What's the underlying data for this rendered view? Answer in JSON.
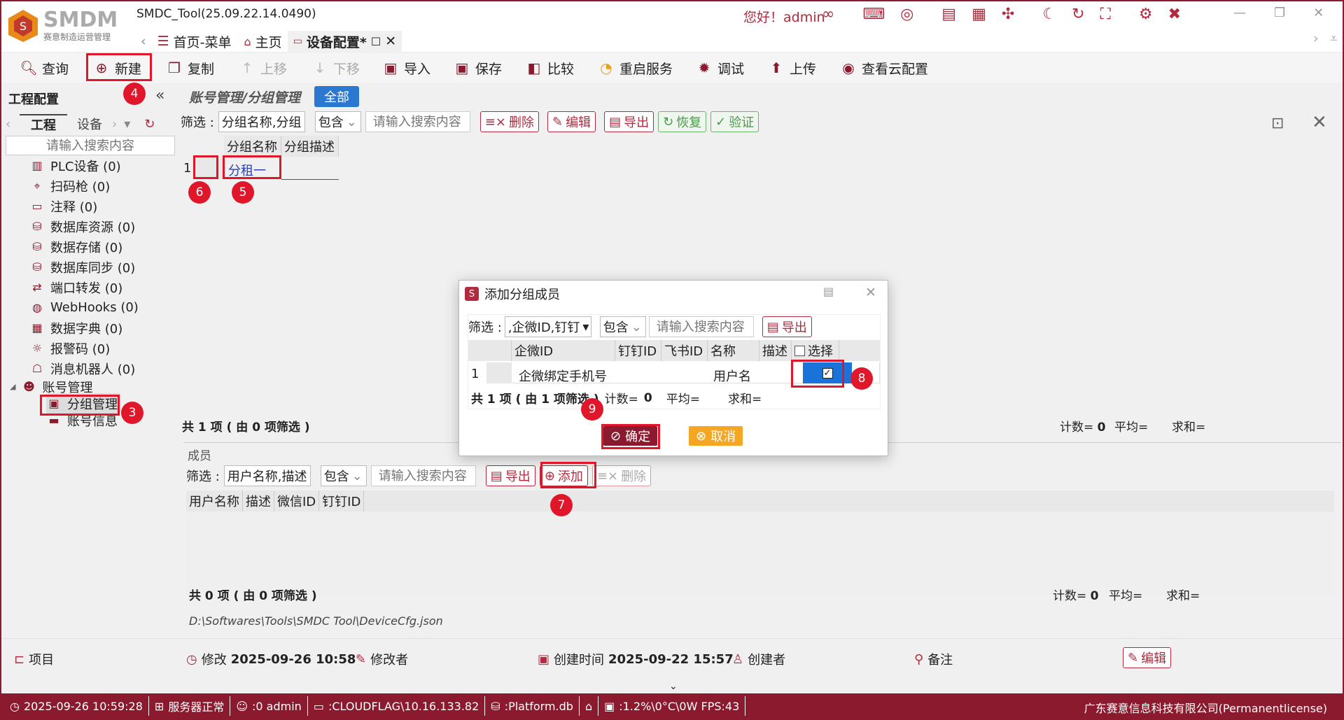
{
  "app": {
    "logo_text": "SMDM",
    "logo_sub": "赛意制造运营管理",
    "title": "SMDC_Tool(25.09.22.14.0490)",
    "greeting": "您好！admin"
  },
  "tabs": [
    {
      "label": "首页-菜单"
    },
    {
      "label": "主页"
    },
    {
      "label": "设备配置*"
    }
  ],
  "toolbar": {
    "query": "查询",
    "new": "新建",
    "copy": "复制",
    "up": "上移",
    "down": "下移",
    "import": "导入",
    "save": "保存",
    "compare": "比较",
    "restart": "重启服务",
    "debug": "调试",
    "upload": "上传",
    "cloud": "查看云配置"
  },
  "left": {
    "title": "工程配置",
    "tab_project": "工程",
    "tab_device": "设备",
    "search_placeholder": "请输入搜索内容",
    "items": [
      "PLC设备 (0)",
      "扫码枪 (0)",
      "注释 (0)",
      "数据库资源 (0)",
      "数据存储 (0)",
      "数据库同步 (0)",
      "端口转发 (0)",
      "WebHooks (0)",
      "数据字典 (0)",
      "报警码 (0)",
      "消息机器人 (0)"
    ],
    "account": "账号管理",
    "group": "分组管理",
    "account_info": "账号信息"
  },
  "main": {
    "breadcrumb": "账号管理/分组管理",
    "all_btn": "全部",
    "filter_label": "筛选 :",
    "filter_field": "分组名称,分组",
    "filter_op": "包含",
    "search_placeholder": "请输入搜索内容",
    "delete": "删除",
    "edit": "编辑",
    "export": "导出",
    "restore": "恢复",
    "verify": "验证",
    "columns": [
      "分组名称",
      "分组描述"
    ],
    "row_num": "1",
    "row_value": "分租一",
    "summary": "共 1 项 ( 由 0 项筛选 )",
    "count_label": "计数=",
    "count_value": "0",
    "avg": "平均=",
    "sum": "求和="
  },
  "members": {
    "title": "成员",
    "filter_label": "筛选 :",
    "filter_field": "用户名称,描述",
    "filter_op": "包含",
    "search_placeholder": "请输入搜索内容",
    "export": "导出",
    "add": "添加",
    "delete": "删除",
    "columns": [
      "用户名称",
      "描述",
      "微信ID",
      "钉钉ID"
    ],
    "summary": "共 0 项 ( 由 0 项筛选 )",
    "count_label": "计数=",
    "count_value": "0",
    "avg": "平均=",
    "sum": "求和="
  },
  "path": "D:\\Softwares\\Tools\\SMDC Tool\\DeviceCfg.json",
  "footer": {
    "project": "项目",
    "modified_label": "修改",
    "modified_value": "2025-09-26 10:58",
    "modifier": "修改者",
    "created_label": "创建时间",
    "created_value": "2025-09-22 15:57",
    "creator": "创建者",
    "note": "备注",
    "edit": "编辑"
  },
  "dialog": {
    "title": "添加分组成员",
    "filter_label": "筛选 :",
    "filter_field": ",企微ID,钉钉",
    "filter_op": "包含",
    "search_placeholder": "请输入搜索内容",
    "export": "导出",
    "columns": [
      "企微ID",
      "钉钉ID",
      "飞书ID",
      "名称",
      "描述",
      "选择"
    ],
    "row_num": "1",
    "row_weixin": "企微绑定手机号",
    "row_name": "用户名",
    "summary": "共 1 项 ( 由 1 项筛选 )",
    "count_label": "计数=",
    "count_value": "0",
    "avg": "平均=",
    "sum": "求和=",
    "ok": "确定",
    "cancel": "取消"
  },
  "badges": [
    "4",
    "3",
    "6",
    "5",
    "7",
    "8",
    "9"
  ],
  "status": {
    "time": "2025-09-26 10:59:28",
    "server": "服务器正常",
    "user": ":0 admin",
    "host": ":CLOUDFLAG\\10.16.133.82",
    "db": ":Platform.db",
    "perf": ":1.2%\\0°C\\0W  FPS:43",
    "company": "广东赛意信息科技有限公司(Permanentlicense)"
  }
}
